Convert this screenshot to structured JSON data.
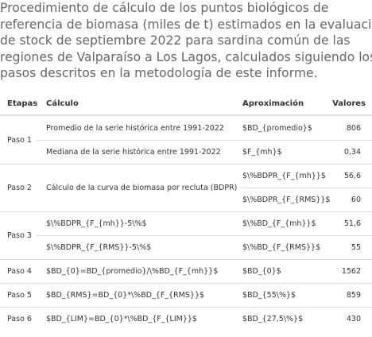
{
  "caption": {
    "lines": [
      "Procedimiento de cálculo de los puntos biológicos de",
      "referencia de biomasa (miles de t) estimados en la evaluación",
      "de stock de septiembre 2022 para sardina común de las",
      "regiones de Valparaíso a Los Lagos, calculados siguiendo los",
      "pasos descritos en la metodología de este informe."
    ]
  },
  "table": {
    "headers": [
      "Etapas",
      "Cálculo",
      "Aproximación",
      "Valores"
    ],
    "rows": [
      {
        "etapa": "Paso 1",
        "calculo": "Promedio de la serie histórica entre 1991-2022",
        "aprox": "$BD_{promedio}$",
        "valor": "806"
      },
      {
        "etapa": "",
        "calculo": "Mediana de la serie histórica entre 1991-2022",
        "aprox": "$F_{mh}$",
        "valor": "0,34"
      },
      {
        "etapa": "Paso 2",
        "calculo": "Cálculo de la curva de biomasa por recluta (BDPR)",
        "aprox": "$\\%BDPR_{F_{mh}}$",
        "valor": "56,6"
      },
      {
        "etapa": "",
        "calculo": "",
        "aprox": "$\\%BDPR_{F_{RMS}}$",
        "valor": "60"
      },
      {
        "etapa": "Paso 3",
        "calculo": "$\\%BDPR_{F_{mh}}-5\\%$",
        "aprox": "$\\%BD_{F_{mh}}$",
        "valor": "51,6"
      },
      {
        "etapa": "",
        "calculo": "$\\%BDPR_{F_{RMS}}-5\\%$",
        "aprox": "$\\%BD_{F_{RMS}}$",
        "valor": "55"
      },
      {
        "etapa": "Paso 4",
        "calculo": "$BD_{0}=BD_{promedio}/\\%BD_{F_{mh}}$",
        "aprox": "$BD_{0}$",
        "valor": "1562"
      },
      {
        "etapa": "Paso 5",
        "calculo": "$BD_{RMS}=BD_{0}*\\%BD_{F_{RMS}}$",
        "aprox": "$BD_{55\\%}$",
        "valor": "859"
      },
      {
        "etapa": "Paso 6",
        "calculo": "$BD_{LIM}=BD_{0}*\\%BD_{F_{LIM}}$",
        "aprox": "$BD_{27,5\\%}$",
        "valor": "430"
      }
    ]
  }
}
